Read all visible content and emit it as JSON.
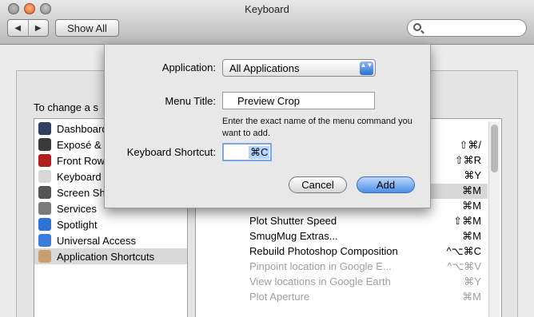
{
  "window": {
    "title": "Keyboard"
  },
  "toolbar": {
    "back_glyph": "◀",
    "forward_glyph": "▶",
    "show_all": "Show All",
    "search_placeholder": "",
    "search_icon": "search-icon"
  },
  "pane": {
    "instruction": "To change a s"
  },
  "categories": [
    {
      "label": "Dashboard",
      "icon": "dashboard-icon",
      "color": "#30415e"
    },
    {
      "label": "Exposé &",
      "icon": "expose-icon",
      "color": "#3a3a3a"
    },
    {
      "label": "Front Row",
      "icon": "front-row-icon",
      "color": "#b01e1e"
    },
    {
      "label": "Keyboard",
      "icon": "keyboard-icon",
      "color": "#d8d8d8"
    },
    {
      "label": "Screen Sh",
      "icon": "camera-icon",
      "color": "#555555"
    },
    {
      "label": "Services",
      "icon": "gear-icon",
      "color": "#7a7a7a"
    },
    {
      "label": "Spotlight",
      "icon": "spotlight-icon",
      "color": "#2e73d6"
    },
    {
      "label": "Universal Access",
      "icon": "universal-access-icon",
      "color": "#3b7bdc"
    },
    {
      "label": "Application Shortcuts",
      "icon": "app-shortcuts-icon",
      "color": "#c8a070"
    }
  ],
  "shortcuts": [
    {
      "name": "",
      "keys": "⇧⌘/",
      "dim": false
    },
    {
      "name": "",
      "keys": "⇧⌘R",
      "dim": false
    },
    {
      "name": "",
      "keys": "⌘Y",
      "dim": false
    },
    {
      "name": "",
      "keys": "⌘M",
      "dim": false
    },
    {
      "name": "",
      "keys": "⌘M",
      "dim": false
    },
    {
      "name": "Plot Shutter Speed",
      "keys": "⇧⌘M",
      "dim": false
    },
    {
      "name": "SmugMug Extras...",
      "keys": "⌘M",
      "dim": false
    },
    {
      "name": "Rebuild Photoshop Composition",
      "keys": "^⌥⌘C",
      "dim": false
    },
    {
      "name": "Pinpoint location in Google E...",
      "keys": "^⌥⌘V",
      "dim": true
    },
    {
      "name": "View locations in Google Earth",
      "keys": "⌘Y",
      "dim": true
    },
    {
      "name": "Plot Aperture",
      "keys": "⌘M",
      "dim": true
    }
  ],
  "sheet": {
    "application_label": "Application:",
    "application_value": "All Applications",
    "popup_arrows": "▲▼",
    "menu_title_label": "Menu Title:",
    "menu_title_value": "Preview Crop",
    "hint": "Enter the exact name of the menu command you want to add.",
    "shortcut_label": "Keyboard Shortcut:",
    "shortcut_value": "⌘C",
    "cancel": "Cancel",
    "add": "Add"
  },
  "colors": {
    "accent": "#4b8fe6",
    "selection": "#b5d5ff"
  }
}
